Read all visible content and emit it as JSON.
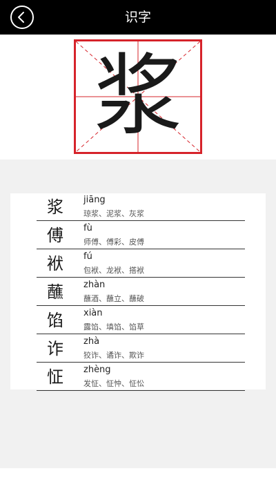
{
  "header": {
    "title": "识字",
    "back_icon": "back-arrow-icon"
  },
  "hero": {
    "character": "浆",
    "grid_color": "#d6232a"
  },
  "items": [
    {
      "char": "浆",
      "pinyin": "jiāng",
      "words": "琼浆、泥浆、灰浆"
    },
    {
      "char": "傅",
      "pinyin": "fù",
      "words": "师傅、傅彩、皮傅"
    },
    {
      "char": "袱",
      "pinyin": "fú",
      "words": "包袱、龙袱、搭袱"
    },
    {
      "char": "蘸",
      "pinyin": "zhàn",
      "words": "蘸酒、蘸立、蘸破"
    },
    {
      "char": "馅",
      "pinyin": "xiàn",
      "words": "露馅、填馅、馅草"
    },
    {
      "char": "诈",
      "pinyin": "zhà",
      "words": "狡诈、谲诈、欺诈"
    },
    {
      "char": "怔",
      "pinyin": "zhèng",
      "words": "发怔、怔忡、怔忪"
    }
  ]
}
